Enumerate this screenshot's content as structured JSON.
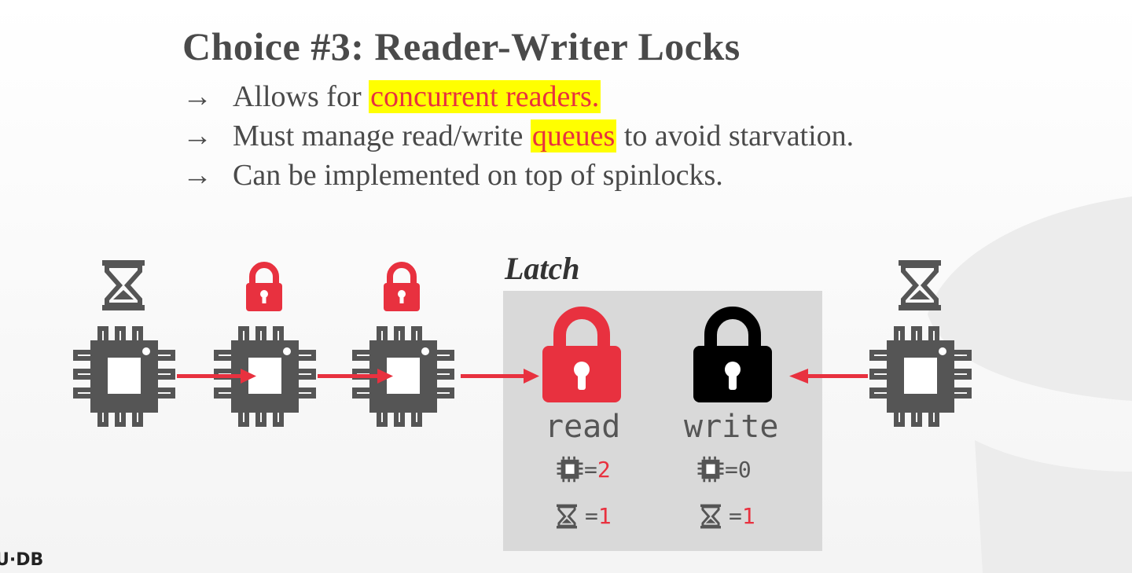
{
  "slide": {
    "title": "Choice #3: Reader-Writer Locks",
    "bullets": [
      {
        "arrow": "→",
        "pre": "Allows for ",
        "highlight": "concurrent readers.",
        "post": ""
      },
      {
        "arrow": "→",
        "pre": "Must manage read/write ",
        "highlight": "queues",
        "post": " to avoid starvation."
      },
      {
        "arrow": "→",
        "pre": "Can be implemented on top of spinlocks.",
        "highlight": "",
        "post": ""
      }
    ]
  },
  "diagram": {
    "latch_label": "Latch",
    "read_label": "read",
    "write_label": "write",
    "read_counts": {
      "cpu_eq": "=",
      "cpu_value": "2",
      "wait_eq": "=",
      "wait_value": "1"
    },
    "write_counts": {
      "cpu_eq": "=",
      "cpu_value": "0",
      "wait_eq": "=",
      "wait_value": "1"
    },
    "colors": {
      "red": "#e8313f",
      "cpu": "#555555",
      "black": "#000000",
      "box": "#d9d9d9"
    }
  },
  "footer": {
    "logo_text": "U·DB"
  }
}
